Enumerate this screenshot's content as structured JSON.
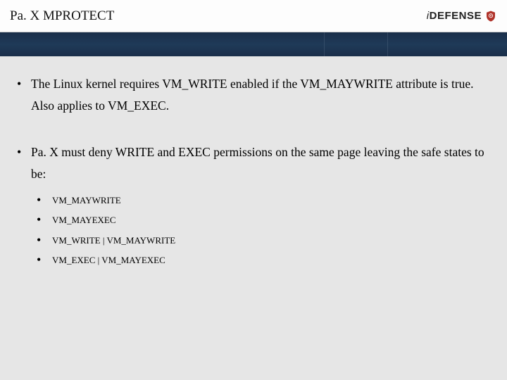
{
  "header": {
    "title": "Pa. X MPROTECT",
    "logo_text_prefix": "i",
    "logo_text_main": "DEFENSE",
    "banner_tick1": "",
    "banner_tick2": ""
  },
  "bullets": [
    {
      "text": "The Linux kernel requires VM_WRITE enabled if the VM_MAYWRITE attribute is true. Also applies to VM_EXEC."
    },
    {
      "text": "Pa. X must deny WRITE and EXEC permissions on the same page leaving the safe states to be:",
      "sub": [
        "VM_MAYWRITE",
        "VM_MAYEXEC",
        "VM_WRITE | VM_MAYWRITE",
        "VM_EXEC | VM_MAYEXEC"
      ]
    }
  ]
}
